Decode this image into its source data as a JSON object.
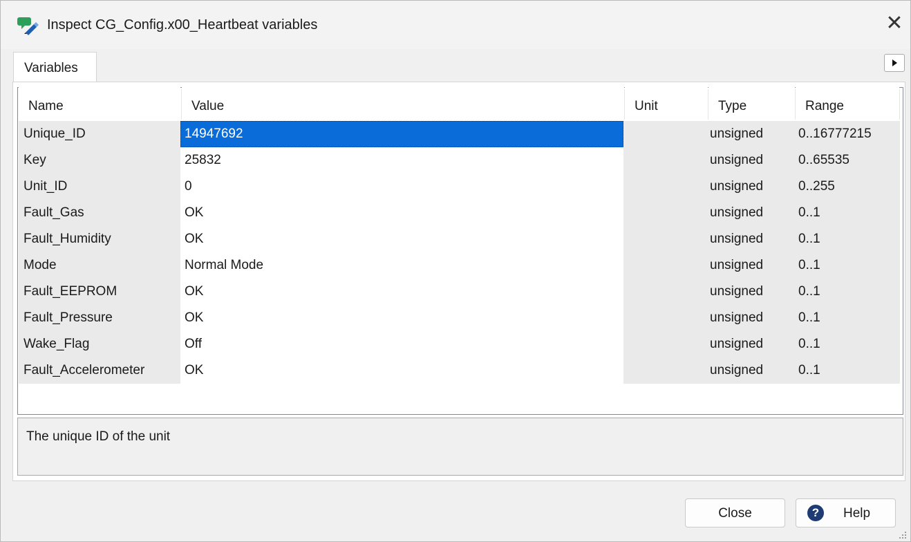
{
  "window": {
    "title": "Inspect CG_Config.x00_Heartbeat variables",
    "close_glyph": "✕"
  },
  "tabs": [
    {
      "label": "Variables",
      "selected": true
    }
  ],
  "table": {
    "columns": [
      "Name",
      "Value",
      "Unit",
      "Type",
      "Range"
    ],
    "rows": [
      {
        "name": "Unique_ID",
        "value": "14947692",
        "unit": "",
        "type": "unsigned",
        "range": "0..16777215",
        "selected": true
      },
      {
        "name": "Key",
        "value": "25832",
        "unit": "",
        "type": "unsigned",
        "range": "0..65535"
      },
      {
        "name": "Unit_ID",
        "value": "0",
        "unit": "",
        "type": "unsigned",
        "range": "0..255"
      },
      {
        "name": "Fault_Gas",
        "value": "OK",
        "unit": "",
        "type": "unsigned",
        "range": "0..1"
      },
      {
        "name": "Fault_Humidity",
        "value": "OK",
        "unit": "",
        "type": "unsigned",
        "range": "0..1"
      },
      {
        "name": "Mode",
        "value": "Normal Mode",
        "unit": "",
        "type": "unsigned",
        "range": "0..1"
      },
      {
        "name": "Fault_EEPROM",
        "value": "OK",
        "unit": "",
        "type": "unsigned",
        "range": "0..1"
      },
      {
        "name": "Fault_Pressure",
        "value": "OK",
        "unit": "",
        "type": "unsigned",
        "range": "0..1"
      },
      {
        "name": "Wake_Flag",
        "value": "Off",
        "unit": "",
        "type": "unsigned",
        "range": "0..1"
      },
      {
        "name": "Fault_Accelerometer",
        "value": "OK",
        "unit": "",
        "type": "unsigned",
        "range": "0..1"
      }
    ]
  },
  "description": "The unique ID of the unit",
  "buttons": {
    "close_label": "Close",
    "help_label": "Help",
    "help_glyph": "?"
  },
  "colors": {
    "selection": "#0a6cd8",
    "row_background": "#eaeaea",
    "help_icon": "#1f3b73"
  },
  "icons": {
    "app": "inspect-app-icon",
    "close": "close-icon",
    "tab_scroll": "chevron-right-icon",
    "help": "help-icon"
  }
}
